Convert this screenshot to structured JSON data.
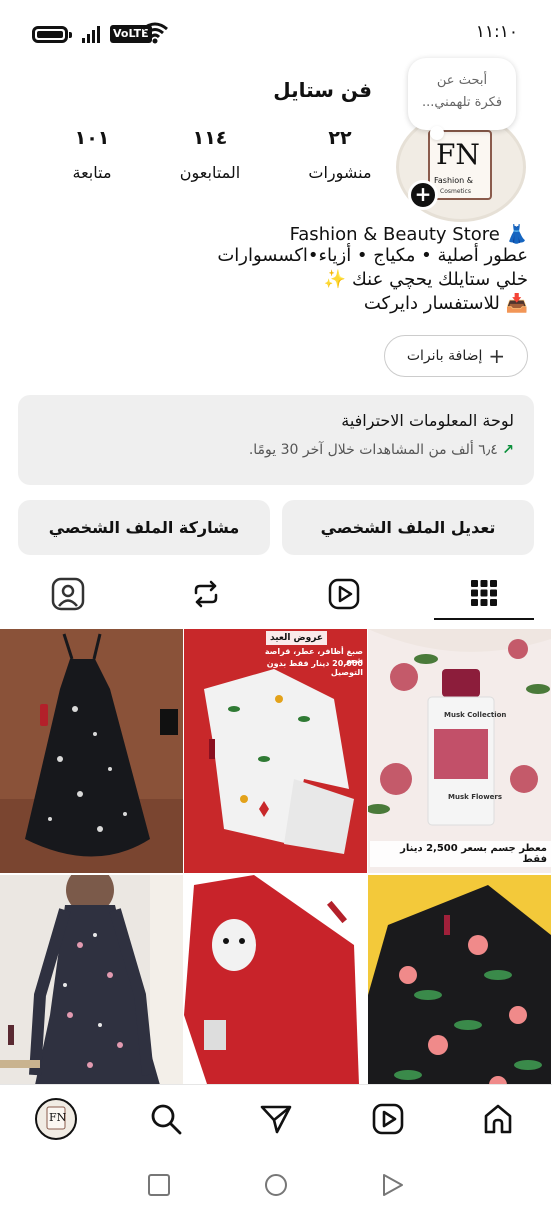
{
  "status_bar": {
    "time": "١١:١٠",
    "network": "VoLTE",
    "battery_level": 0.9
  },
  "profile": {
    "username": "فن ستايل",
    "note": {
      "line1": "أبحث عن",
      "line2": "فكرة تلهمني..."
    },
    "avatar_logo": {
      "initials": "FN",
      "line1": "Fashion &",
      "line2": "Cosmetics"
    },
    "stats": [
      {
        "value": "٢٢",
        "label": "منشورات"
      },
      {
        "value": "١١٤",
        "label": "المتابعون"
      },
      {
        "value": "١٠١",
        "label": "متابعة"
      }
    ],
    "bio": [
      "Fashion & Beauty Store 👗",
      "عطور أصلية • مكياج • أزياء•اكسسوارات",
      "خلي ستايلك يحچي عنك ✨",
      "📥 للاستفسار دايركت"
    ],
    "add_banners_label": "إضافة بانرات"
  },
  "dashboard": {
    "title": "لوحة المعلومات الاحترافية",
    "subtitle": "٦٫٤ ألف من المشاهدات خلال آخر 30 يومًا."
  },
  "buttons": {
    "edit_profile": "تعديل الملف الشخصي",
    "share_profile": "مشاركة الملف الشخصي"
  },
  "tabs": [
    {
      "name": "grid",
      "active": true
    },
    {
      "name": "reels",
      "active": false
    },
    {
      "name": "reposts",
      "active": false
    },
    {
      "name": "tagged",
      "active": false
    }
  ],
  "posts": {
    "p1_caption": "عروض العيد",
    "p1_line2": "صبغ أظافر، عطر، قراصة شعر",
    "p1_line3": "20,000 دينار فقط بدون التوصيل",
    "p2_caption": "معطر جسم بسعر 2,500 دينار فقط",
    "p2_bottle_label": "Musk Collection",
    "p2_bottle_name": "Musk Flowers"
  },
  "colors": {
    "accent_green": "#0a8f3a",
    "tile_red": "#c8282a",
    "tile_brown": "#8a5239"
  }
}
